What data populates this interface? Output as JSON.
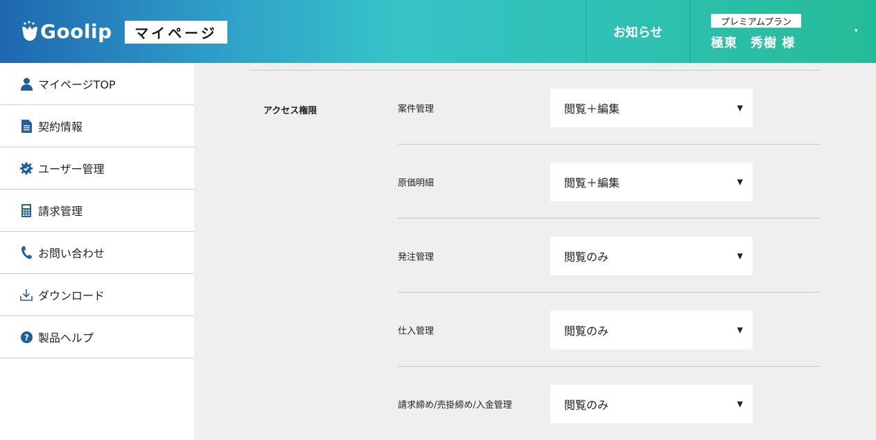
{
  "header": {
    "logo_text": "Goolip",
    "mypage_label": "マイページ",
    "notice_label": "お知らせ",
    "plan_badge": "プレミアムプラン",
    "user_name": "極東　秀樹 様"
  },
  "sidebar": {
    "items": [
      {
        "label": "マイページTOP",
        "icon": "user-icon"
      },
      {
        "label": "契約情報",
        "icon": "document-icon"
      },
      {
        "label": "ユーザー管理",
        "icon": "gear-check-icon"
      },
      {
        "label": "請求管理",
        "icon": "calculator-icon"
      },
      {
        "label": "お問い合わせ",
        "icon": "phone-icon"
      },
      {
        "label": "ダウンロード",
        "icon": "download-icon"
      },
      {
        "label": "製品ヘルプ",
        "icon": "help-icon"
      }
    ]
  },
  "main": {
    "section_label": "アクセス権限",
    "permissions": [
      {
        "label": "案件管理",
        "value": "閲覧＋編集"
      },
      {
        "label": "原価明細",
        "value": "閲覧＋編集"
      },
      {
        "label": "発注管理",
        "value": "閲覧のみ"
      },
      {
        "label": "仕入管理",
        "value": "閲覧のみ"
      },
      {
        "label": "請求締め/売掛締め/入金管理",
        "value": "閲覧のみ"
      }
    ]
  },
  "colors": {
    "header_start": "#1f67b0",
    "header_end": "#26bb97",
    "icon_blue": "#1e5f9e"
  }
}
